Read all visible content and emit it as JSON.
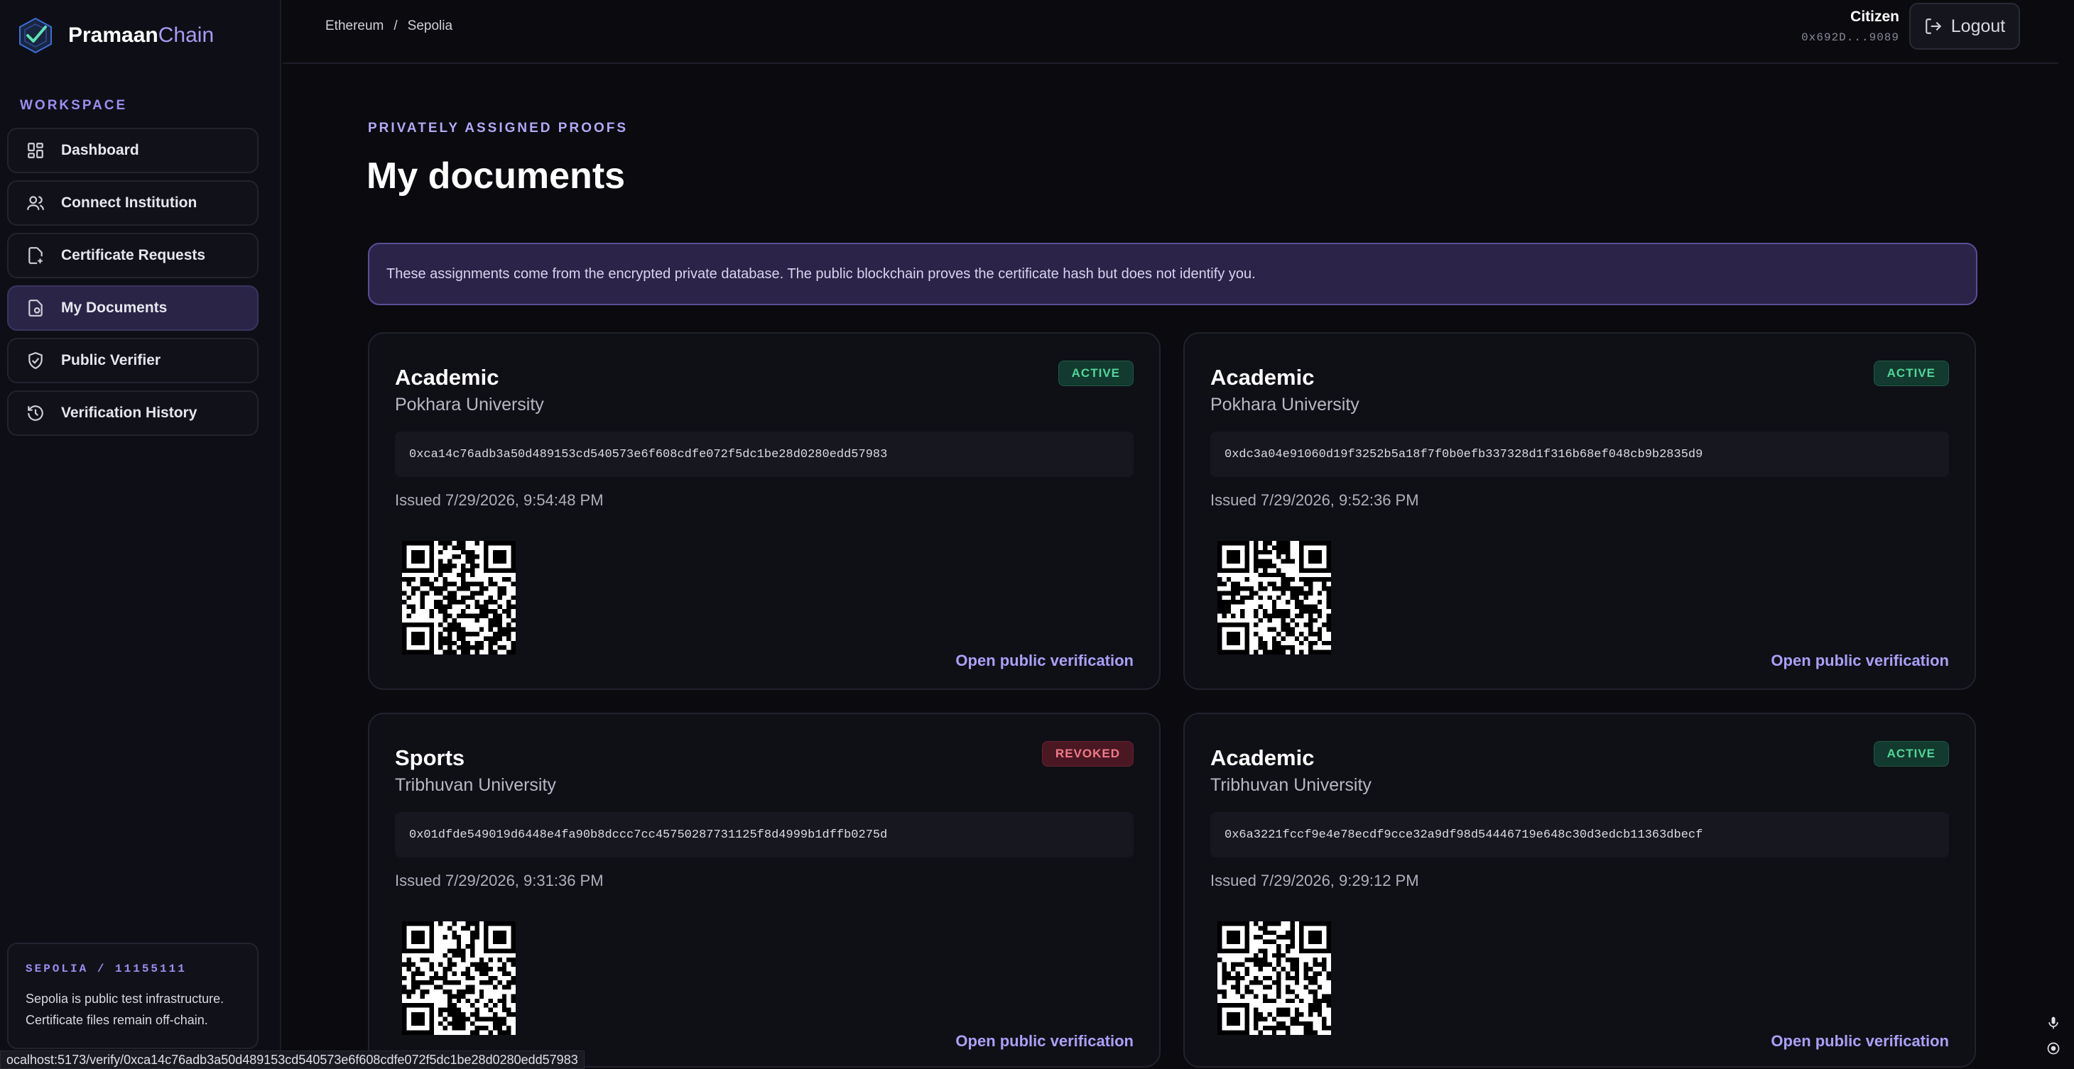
{
  "brand": {
    "name_part1": "Pramaan",
    "name_part2": "Chain"
  },
  "sidebar": {
    "section_label": "WORKSPACE",
    "items": [
      {
        "label": "Dashboard",
        "icon": "dashboard-icon"
      },
      {
        "label": "Connect Institution",
        "icon": "users-icon"
      },
      {
        "label": "Certificate Requests",
        "icon": "file-request-icon"
      },
      {
        "label": "My Documents",
        "icon": "documents-icon",
        "active": true
      },
      {
        "label": "Public Verifier",
        "icon": "shield-icon"
      },
      {
        "label": "Verification History",
        "icon": "history-icon"
      }
    ],
    "network": {
      "title": "SEPOLIA / 11155111",
      "line1": "Sepolia is public test infrastructure.",
      "line2": "Certificate files remain off-chain."
    }
  },
  "header": {
    "breadcrumb": [
      "Ethereum",
      "/",
      "Sepolia"
    ],
    "user_role": "Citizen",
    "user_address": "0x692D...9089",
    "logout_label": "Logout"
  },
  "main": {
    "kicker": "PRIVATELY ASSIGNED PROOFS",
    "title": "My documents",
    "notice": "These assignments come from the encrypted private database. The public blockchain proves the certificate hash but does not identify you.",
    "documents": [
      {
        "type": "Academic",
        "institution": "Pokhara University",
        "status": "ACTIVE",
        "hash": "0xca14c76adb3a50d489153cd540573e6f608cdfe072f5dc1be28d0280edd57983",
        "issued": "Issued 7/29/2026, 9:54:48 PM",
        "link": "Open public verification"
      },
      {
        "type": "Academic",
        "institution": "Pokhara University",
        "status": "ACTIVE",
        "hash": "0xdc3a04e91060d19f3252b5a18f7f0b0efb337328d1f316b68ef048cb9b2835d9",
        "issued": "Issued 7/29/2026, 9:52:36 PM",
        "link": "Open public verification"
      },
      {
        "type": "Sports",
        "institution": "Tribhuvan University",
        "status": "REVOKED",
        "hash": "0x01dfde549019d6448e4fa90b8dccc7cc45750287731125f8d4999b1dffb0275d",
        "issued": "Issued 7/29/2026, 9:31:36 PM",
        "link": "Open public verification"
      },
      {
        "type": "Academic",
        "institution": "Tribhuvan University",
        "status": "ACTIVE",
        "hash": "0x6a3221fccf9e4e78ecdf9cce32a9df98d54446719e648c30d3edcb11363dbecf",
        "issued": "Issued 7/29/2026, 9:29:12 PM",
        "link": "Open public verification"
      }
    ]
  },
  "status_bar": {
    "url": "ocalhost:5173/verify/0xca14c76adb3a50d489153cd540573e6f608cdfe072f5dc1be28d0280edd57983"
  },
  "colors": {
    "accent": "#a79cf5",
    "active": "#54d59a",
    "revoked": "#f07a8a",
    "background": "#0a0a0f"
  }
}
